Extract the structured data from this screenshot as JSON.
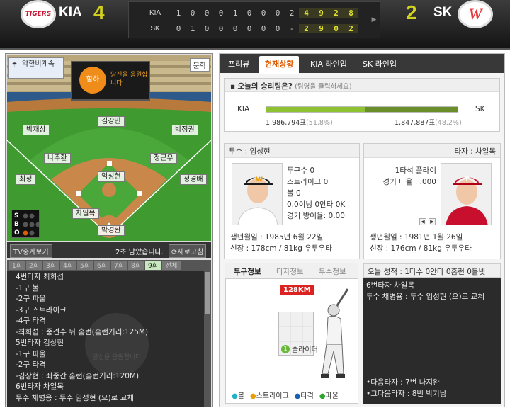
{
  "scoreboard": {
    "away": {
      "name": "KIA",
      "logo_text": "TIGERS",
      "score": "4",
      "line": [
        "1",
        "0",
        "0",
        "0",
        "1",
        "0",
        "0",
        "0",
        "2"
      ],
      "r": "4",
      "h": "9",
      "e": "2",
      "b": "8",
      "color": "#c8102e"
    },
    "home": {
      "name": "SK",
      "logo_text": "W",
      "score": "2",
      "line": [
        "0",
        "1",
        "0",
        "0",
        "0",
        "0",
        "0",
        "0",
        "-"
      ],
      "r": "2",
      "h": "9",
      "e": "0",
      "b": "2",
      "color": "#e8383d"
    }
  },
  "field": {
    "weather": "약한비계속",
    "stadium": "문학",
    "ad_text": "당신을 응원합니다",
    "ad_logo": "할하",
    "positions": {
      "cf": "김강민",
      "lf": "박재상",
      "rf": "박정권",
      "ss": "나주환",
      "b2": "정근우",
      "b3": "최정",
      "b1": "정경배",
      "p": "임성현",
      "batter": "차일목",
      "c": "박경완"
    },
    "count_labels": [
      "S",
      "B",
      "O"
    ],
    "count_colors": {
      "strike": "#e8a000",
      "ball": "#2fa52f",
      "out": "#e05a00"
    }
  },
  "broadcast": {
    "tv_button": "TV중계보기",
    "countdown": "2초 남았습니다.",
    "refresh_button": "새로고침"
  },
  "innings_tabs": [
    "1회",
    "2회",
    "3회",
    "4회",
    "5회",
    "6회",
    "7회",
    "8회",
    "9회",
    "전체"
  ],
  "active_inning": "9회",
  "play_log": [
    "4번타자 최희섭",
    "-1구 볼",
    "-2구 파울",
    "-3구 스트라이크",
    "-4구 타격",
    "-최희섭 : 중견수 뒤 홈런(홈런거리:125M)",
    "5번타자 김상현",
    "-1구 파울",
    "-2구 타격",
    "-김상현 : 좌중간 홈런(홈런거리:120M)",
    "6번타자 차일목",
    "투수 채병용 : 투수 임성현 (으)로 교체"
  ],
  "log_watermark": "당신을 응원합니다",
  "tabs": [
    "프리뷰",
    "현재상황",
    "KIA 라인업",
    "SK 라인업"
  ],
  "active_tab": "현재상황",
  "vote": {
    "title": "오늘의 승리팀은?",
    "hint": "(팀명을 클릭하세요)",
    "left_team": "KIA",
    "right_team": "SK",
    "left_votes": "1,986,794표",
    "left_pct_label": "(51.8%)",
    "right_votes": "1,847,887표",
    "right_pct_label": "(48.2%)",
    "left_share": 51.8,
    "left_color": "#8fc232",
    "right_color": "#6a8e2a"
  },
  "pitcher": {
    "header_label": "투수 : 임성현",
    "stats": [
      "투구수 0",
      "스트라이크 0",
      "볼 0",
      "0.0이닝 0안타 0K",
      "경기 방어율: 0.00"
    ],
    "birth": "생년월일 : 1985년 6월 22일",
    "body": "신장 : 178cm / 81kg 우투우타"
  },
  "batter": {
    "header_label": "타자 : 차일목",
    "stats": [
      "1타석 플라이",
      "경기 타율 : .000"
    ],
    "birth": "생년월일 : 1981년 1월 26일",
    "body": "신장 : 176cm / 81kg 우투우타"
  },
  "pitch_tabs": [
    "투구정보",
    "타자정보",
    "투수정보"
  ],
  "pitch": {
    "speed": "128KM",
    "pitch_no": "1",
    "pitch_type": "슬라이더",
    "legend": [
      {
        "label": "볼",
        "color": "#22b2c8"
      },
      {
        "label": "스트라이크",
        "color": "#e8a000"
      },
      {
        "label": "타격",
        "color": "#1a5fb4"
      },
      {
        "label": "파울",
        "color": "#2fa52f"
      }
    ]
  },
  "today_record": "오늘 성적 : 1타수 0안타 0홈런 0볼넷",
  "event_lines": [
    "6번타자 차일목",
    "투수 채병용 : 투수 임성현 (으)로 교체"
  ],
  "next_batters": [
    "•다음타자 : 7번 나지완",
    "•그다음타자 : 8번 박기남"
  ]
}
